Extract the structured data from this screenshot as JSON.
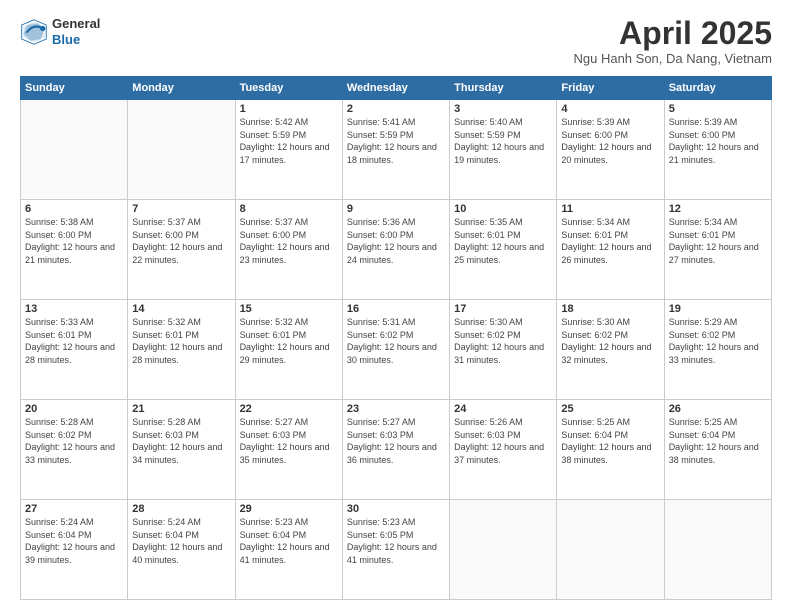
{
  "header": {
    "logo": {
      "general": "General",
      "blue": "Blue"
    },
    "title": "April 2025",
    "location": "Ngu Hanh Son, Da Nang, Vietnam"
  },
  "calendar": {
    "days_of_week": [
      "Sunday",
      "Monday",
      "Tuesday",
      "Wednesday",
      "Thursday",
      "Friday",
      "Saturday"
    ],
    "weeks": [
      [
        {
          "day": "",
          "sunrise": "",
          "sunset": "",
          "daylight": ""
        },
        {
          "day": "",
          "sunrise": "",
          "sunset": "",
          "daylight": ""
        },
        {
          "day": "1",
          "sunrise": "Sunrise: 5:42 AM",
          "sunset": "Sunset: 5:59 PM",
          "daylight": "Daylight: 12 hours and 17 minutes."
        },
        {
          "day": "2",
          "sunrise": "Sunrise: 5:41 AM",
          "sunset": "Sunset: 5:59 PM",
          "daylight": "Daylight: 12 hours and 18 minutes."
        },
        {
          "day": "3",
          "sunrise": "Sunrise: 5:40 AM",
          "sunset": "Sunset: 5:59 PM",
          "daylight": "Daylight: 12 hours and 19 minutes."
        },
        {
          "day": "4",
          "sunrise": "Sunrise: 5:39 AM",
          "sunset": "Sunset: 6:00 PM",
          "daylight": "Daylight: 12 hours and 20 minutes."
        },
        {
          "day": "5",
          "sunrise": "Sunrise: 5:39 AM",
          "sunset": "Sunset: 6:00 PM",
          "daylight": "Daylight: 12 hours and 21 minutes."
        }
      ],
      [
        {
          "day": "6",
          "sunrise": "Sunrise: 5:38 AM",
          "sunset": "Sunset: 6:00 PM",
          "daylight": "Daylight: 12 hours and 21 minutes."
        },
        {
          "day": "7",
          "sunrise": "Sunrise: 5:37 AM",
          "sunset": "Sunset: 6:00 PM",
          "daylight": "Daylight: 12 hours and 22 minutes."
        },
        {
          "day": "8",
          "sunrise": "Sunrise: 5:37 AM",
          "sunset": "Sunset: 6:00 PM",
          "daylight": "Daylight: 12 hours and 23 minutes."
        },
        {
          "day": "9",
          "sunrise": "Sunrise: 5:36 AM",
          "sunset": "Sunset: 6:00 PM",
          "daylight": "Daylight: 12 hours and 24 minutes."
        },
        {
          "day": "10",
          "sunrise": "Sunrise: 5:35 AM",
          "sunset": "Sunset: 6:01 PM",
          "daylight": "Daylight: 12 hours and 25 minutes."
        },
        {
          "day": "11",
          "sunrise": "Sunrise: 5:34 AM",
          "sunset": "Sunset: 6:01 PM",
          "daylight": "Daylight: 12 hours and 26 minutes."
        },
        {
          "day": "12",
          "sunrise": "Sunrise: 5:34 AM",
          "sunset": "Sunset: 6:01 PM",
          "daylight": "Daylight: 12 hours and 27 minutes."
        }
      ],
      [
        {
          "day": "13",
          "sunrise": "Sunrise: 5:33 AM",
          "sunset": "Sunset: 6:01 PM",
          "daylight": "Daylight: 12 hours and 28 minutes."
        },
        {
          "day": "14",
          "sunrise": "Sunrise: 5:32 AM",
          "sunset": "Sunset: 6:01 PM",
          "daylight": "Daylight: 12 hours and 28 minutes."
        },
        {
          "day": "15",
          "sunrise": "Sunrise: 5:32 AM",
          "sunset": "Sunset: 6:01 PM",
          "daylight": "Daylight: 12 hours and 29 minutes."
        },
        {
          "day": "16",
          "sunrise": "Sunrise: 5:31 AM",
          "sunset": "Sunset: 6:02 PM",
          "daylight": "Daylight: 12 hours and 30 minutes."
        },
        {
          "day": "17",
          "sunrise": "Sunrise: 5:30 AM",
          "sunset": "Sunset: 6:02 PM",
          "daylight": "Daylight: 12 hours and 31 minutes."
        },
        {
          "day": "18",
          "sunrise": "Sunrise: 5:30 AM",
          "sunset": "Sunset: 6:02 PM",
          "daylight": "Daylight: 12 hours and 32 minutes."
        },
        {
          "day": "19",
          "sunrise": "Sunrise: 5:29 AM",
          "sunset": "Sunset: 6:02 PM",
          "daylight": "Daylight: 12 hours and 33 minutes."
        }
      ],
      [
        {
          "day": "20",
          "sunrise": "Sunrise: 5:28 AM",
          "sunset": "Sunset: 6:02 PM",
          "daylight": "Daylight: 12 hours and 33 minutes."
        },
        {
          "day": "21",
          "sunrise": "Sunrise: 5:28 AM",
          "sunset": "Sunset: 6:03 PM",
          "daylight": "Daylight: 12 hours and 34 minutes."
        },
        {
          "day": "22",
          "sunrise": "Sunrise: 5:27 AM",
          "sunset": "Sunset: 6:03 PM",
          "daylight": "Daylight: 12 hours and 35 minutes."
        },
        {
          "day": "23",
          "sunrise": "Sunrise: 5:27 AM",
          "sunset": "Sunset: 6:03 PM",
          "daylight": "Daylight: 12 hours and 36 minutes."
        },
        {
          "day": "24",
          "sunrise": "Sunrise: 5:26 AM",
          "sunset": "Sunset: 6:03 PM",
          "daylight": "Daylight: 12 hours and 37 minutes."
        },
        {
          "day": "25",
          "sunrise": "Sunrise: 5:25 AM",
          "sunset": "Sunset: 6:04 PM",
          "daylight": "Daylight: 12 hours and 38 minutes."
        },
        {
          "day": "26",
          "sunrise": "Sunrise: 5:25 AM",
          "sunset": "Sunset: 6:04 PM",
          "daylight": "Daylight: 12 hours and 38 minutes."
        }
      ],
      [
        {
          "day": "27",
          "sunrise": "Sunrise: 5:24 AM",
          "sunset": "Sunset: 6:04 PM",
          "daylight": "Daylight: 12 hours and 39 minutes."
        },
        {
          "day": "28",
          "sunrise": "Sunrise: 5:24 AM",
          "sunset": "Sunset: 6:04 PM",
          "daylight": "Daylight: 12 hours and 40 minutes."
        },
        {
          "day": "29",
          "sunrise": "Sunrise: 5:23 AM",
          "sunset": "Sunset: 6:04 PM",
          "daylight": "Daylight: 12 hours and 41 minutes."
        },
        {
          "day": "30",
          "sunrise": "Sunrise: 5:23 AM",
          "sunset": "Sunset: 6:05 PM",
          "daylight": "Daylight: 12 hours and 41 minutes."
        },
        {
          "day": "",
          "sunrise": "",
          "sunset": "",
          "daylight": ""
        },
        {
          "day": "",
          "sunrise": "",
          "sunset": "",
          "daylight": ""
        },
        {
          "day": "",
          "sunrise": "",
          "sunset": "",
          "daylight": ""
        }
      ]
    ]
  }
}
